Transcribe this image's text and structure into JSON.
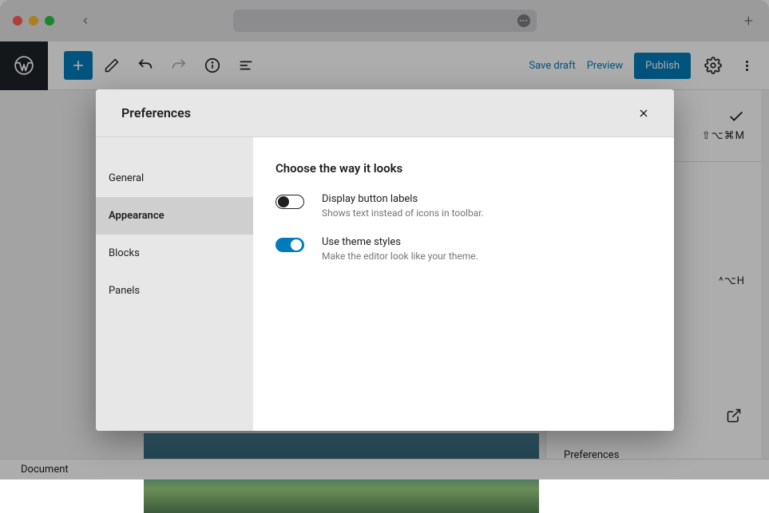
{
  "editor": {
    "save_draft": "Save draft",
    "preview": "Preview",
    "publish": "Publish"
  },
  "right_rail": {
    "shortcut1": "⇧⌥⌘M",
    "shortcut2": "^⌥H",
    "menu_item": "Preferences"
  },
  "statusbar": {
    "label": "Document"
  },
  "modal": {
    "title": "Preferences",
    "nav": {
      "general": "General",
      "appearance": "Appearance",
      "blocks": "Blocks",
      "panels": "Panels"
    },
    "section_title": "Choose the way it looks",
    "opt1": {
      "label": "Display button labels",
      "desc": "Shows text instead of icons in toolbar.",
      "value": false
    },
    "opt2": {
      "label": "Use theme styles",
      "desc": "Make the editor look like your theme.",
      "value": true
    }
  }
}
